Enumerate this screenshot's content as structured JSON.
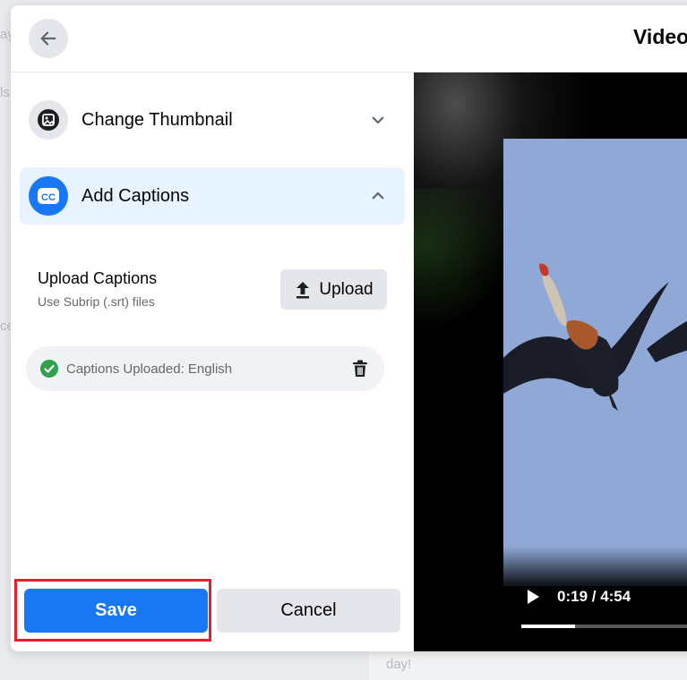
{
  "background": {
    "fragments": [
      "ay",
      "ls",
      "ce",
      "day!"
    ]
  },
  "header": {
    "title": "Video",
    "back_icon": "arrow-left-icon"
  },
  "accordion": [
    {
      "label": "Change Thumbnail",
      "icon": "thumbnail-image-icon",
      "expanded": false
    },
    {
      "label": "Add Captions",
      "icon": "cc-icon",
      "expanded": true
    }
  ],
  "captions": {
    "upload_title": "Upload Captions",
    "upload_subtitle": "Use Subrip (.srt) files",
    "upload_button": "Upload",
    "uploaded_text": "Captions Uploaded: English"
  },
  "footer": {
    "save_label": "Save",
    "cancel_label": "Cancel"
  },
  "video": {
    "time": "0:19 / 4:54",
    "progress": 0.3
  },
  "colors": {
    "accent": "#1877f2",
    "highlight": "#e41e2a",
    "success": "#31a24c"
  }
}
